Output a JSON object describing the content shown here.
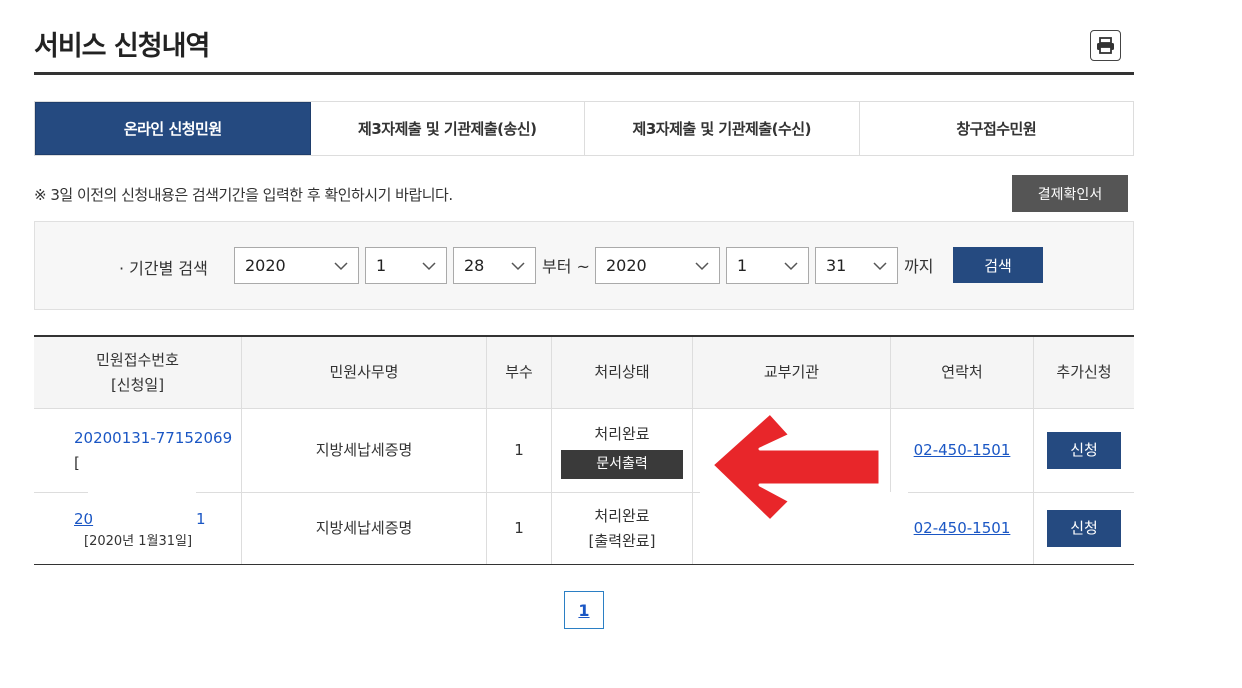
{
  "page": {
    "title": "서비스 신청내역",
    "print_icon": "printer-icon"
  },
  "tabs": [
    {
      "label": "온라인 신청민원",
      "active": true
    },
    {
      "label": "제3자제출 및 기관제출(송신)",
      "active": false
    },
    {
      "label": "제3자제출 및 기관제출(수신)",
      "active": false
    },
    {
      "label": "창구접수민원",
      "active": false
    }
  ],
  "notice": "※ 3일 이전의 신청내용은 검색기간을 입력한 후 확인하시기 바랍니다.",
  "receipt_button": "결제확인서",
  "search": {
    "label": "· 기간별 검색",
    "from_year": "2020",
    "from_month": "1",
    "from_day": "28",
    "from_text": "부터 ~",
    "to_year": "2020",
    "to_month": "1",
    "to_day": "31",
    "to_text": "까지",
    "button": "검색"
  },
  "table": {
    "headers": [
      "민원접수번호",
      "[신청일]",
      "민원사무명",
      "부수",
      "처리상태",
      "교부기관",
      "연락처",
      "추가신청"
    ],
    "rows": [
      {
        "receipt_no": "20200131-77152069",
        "date": "[",
        "service": "지방세납세증명",
        "copies": "1",
        "status": "처리완료",
        "action": "문서출력",
        "agency": "",
        "phone": "02-450-1501",
        "apply": "신청"
      },
      {
        "receipt_no": "20",
        "receipt_no_tail": "1",
        "date": "[2020년 1월31일]",
        "service": "지방세납세증명",
        "copies": "1",
        "status": "처리완료",
        "action": "[출력완료]",
        "agency": "",
        "phone": "02-450-1501",
        "apply": "신청"
      }
    ]
  },
  "pagination": {
    "current": "1"
  },
  "colors": {
    "primary": "#254a80",
    "dark_button": "#3a3a3a",
    "link": "#1a56c4",
    "arrow": "#e8262a"
  }
}
